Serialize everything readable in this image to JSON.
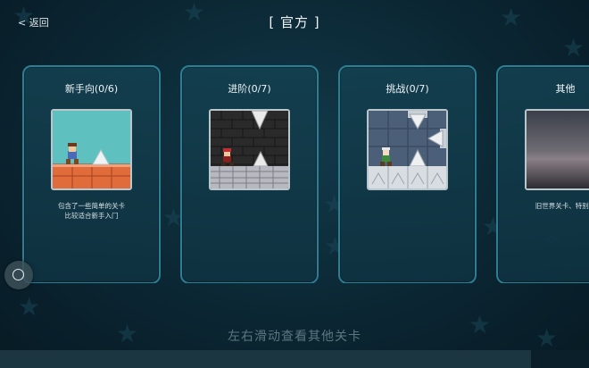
{
  "header": {
    "back_label": "< 返回",
    "title": "[ 官方 ]"
  },
  "cards": [
    {
      "title": "新手向(0/6)",
      "description": "包含了一些简单的关卡\n比较适合新手入门",
      "thumbnail": "beginner-level-preview"
    },
    {
      "title": "进阶(0/7)",
      "description": "",
      "thumbnail": "advanced-level-preview"
    },
    {
      "title": "挑战(0/7)",
      "description": "",
      "thumbnail": "challenge-level-preview"
    },
    {
      "title": "其他",
      "description": "旧世界关卡、特别响",
      "thumbnail": "other-level-preview"
    }
  ],
  "hint": "左右滑动查看其他关卡",
  "scroll": {
    "position_fraction": 0.9
  },
  "colors": {
    "card_border": "#2d7d93",
    "background": "#0b2633",
    "hint_text": "#5d7780"
  }
}
